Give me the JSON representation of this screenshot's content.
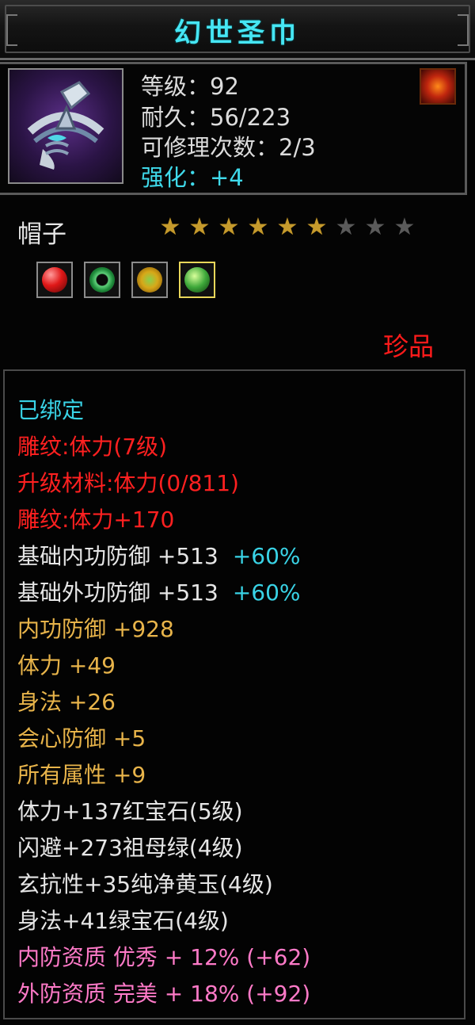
{
  "title": "幻世圣巾",
  "item": {
    "icon": "ornate-headband-icon",
    "level": "等级：92",
    "durability": "耐久：56/223",
    "repair_count": "可修理次数：2/3",
    "enhance": "强化：+4",
    "badge_icon": "fire-swirl-icon",
    "type": "帽子",
    "stars": {
      "filled": 6,
      "total": 9
    },
    "rarity": "珍品"
  },
  "gems": [
    {
      "icon": "red-gem-icon",
      "color": "#e01818"
    },
    {
      "icon": "emerald-ring-icon",
      "color": "#1e8a3a"
    },
    {
      "icon": "yellow-jade-icon",
      "color": "#d8a818"
    },
    {
      "icon": "green-gem-icon",
      "color": "#3ea83a"
    }
  ],
  "attributes": {
    "bound": "已绑定",
    "engrave1": "雕纹:体力(7级)",
    "upgrade_material": "升级材料:体力(0/811)",
    "engrave2": "雕纹:体力+170",
    "base_inner_def": "基础内功防御 +513",
    "base_inner_def_pct": "+60%",
    "base_outer_def": "基础外功防御 +513",
    "base_outer_def_pct": "+60%",
    "inner_def": "内功防御 +928",
    "vitality": "体力 +49",
    "agility": "身法 +26",
    "crit_def": "会心防御 +5",
    "all_attr": "所有属性 +9",
    "gem1": "体力+137红宝石(5级)",
    "gem2": "闪避+273祖母绿(4级)",
    "gem3": "玄抗性+35纯净黄玉(4级)",
    "gem4": "身法+41绿宝石(4级)",
    "quality_inner": "内防资质 优秀 + 12% (+62)",
    "quality_outer": "外防资质 完美 + 18% (+92)"
  },
  "colors": {
    "title": "#46e6f4",
    "red": "#ff2020",
    "yellow": "#e8b44a",
    "cyan": "#39d3e6",
    "pink": "#ff7ac8"
  }
}
